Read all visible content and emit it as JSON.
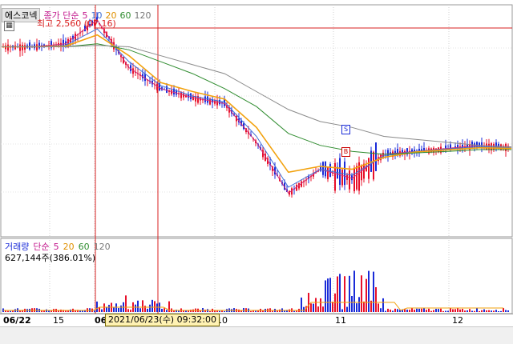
{
  "chart": {
    "stock_tag": "에스코넥",
    "price_indicator": "종가 단순",
    "ma_periods": [
      "5",
      "10",
      "20",
      "60",
      "120"
    ],
    "high_label": "최고 2,560 (07.16)",
    "volume_tag": "거래량",
    "volume_indicator": "단순",
    "volume_ma_periods": [
      "5",
      "20",
      "60",
      "120"
    ],
    "volume_value": "627,144주(386.01%)",
    "cursor_datetime": "2021/06/23(수) 09:32:00",
    "buy_marker": "B",
    "sell_marker": "S"
  },
  "colors": {
    "up": "#e8102a",
    "down": "#1a2bd8",
    "ma5": "#d2327a",
    "ma10": "#3f6fd6",
    "ma20": "#f2a20e",
    "ma60": "#2f8c2f",
    "ma120": "#8a8a8a",
    "cursor": "#d92020"
  },
  "chart_data": {
    "type": "candlestick",
    "x_labels": [
      "06/22",
      "15",
      "06",
      "10",
      "11",
      "12"
    ],
    "series": [
      {
        "name": "5",
        "values": [
          2470,
          2470,
          2480,
          2560,
          2400,
          2330,
          2300,
          2280,
          2150,
          1980,
          2060,
          2030,
          2110,
          2120,
          2130,
          2140,
          2135
        ]
      },
      {
        "name": "10",
        "values": [
          2470,
          2470,
          2475,
          2530,
          2420,
          2340,
          2305,
          2285,
          2170,
          2000,
          2060,
          2040,
          2105,
          2120,
          2128,
          2136,
          2132
        ]
      },
      {
        "name": "20",
        "values": [
          2470,
          2470,
          2472,
          2510,
          2440,
          2350,
          2320,
          2295,
          2200,
          2050,
          2070,
          2060,
          2100,
          2118,
          2125,
          2132,
          2130
        ]
      },
      {
        "name": "60",
        "values": [
          2470,
          2470,
          2470,
          2480,
          2460,
          2420,
          2380,
          2330,
          2270,
          2180,
          2140,
          2120,
          2110,
          2115,
          2120,
          2126,
          2126
        ]
      },
      {
        "name": "120",
        "values": [
          2470,
          2470,
          2470,
          2475,
          2470,
          2440,
          2410,
          2380,
          2320,
          2260,
          2220,
          2200,
          2170,
          2160,
          2150,
          2140,
          2135
        ]
      }
    ],
    "volume_series": [
      {
        "name": "거래량",
        "values": [
          627144
        ]
      }
    ],
    "high": 2560
  }
}
